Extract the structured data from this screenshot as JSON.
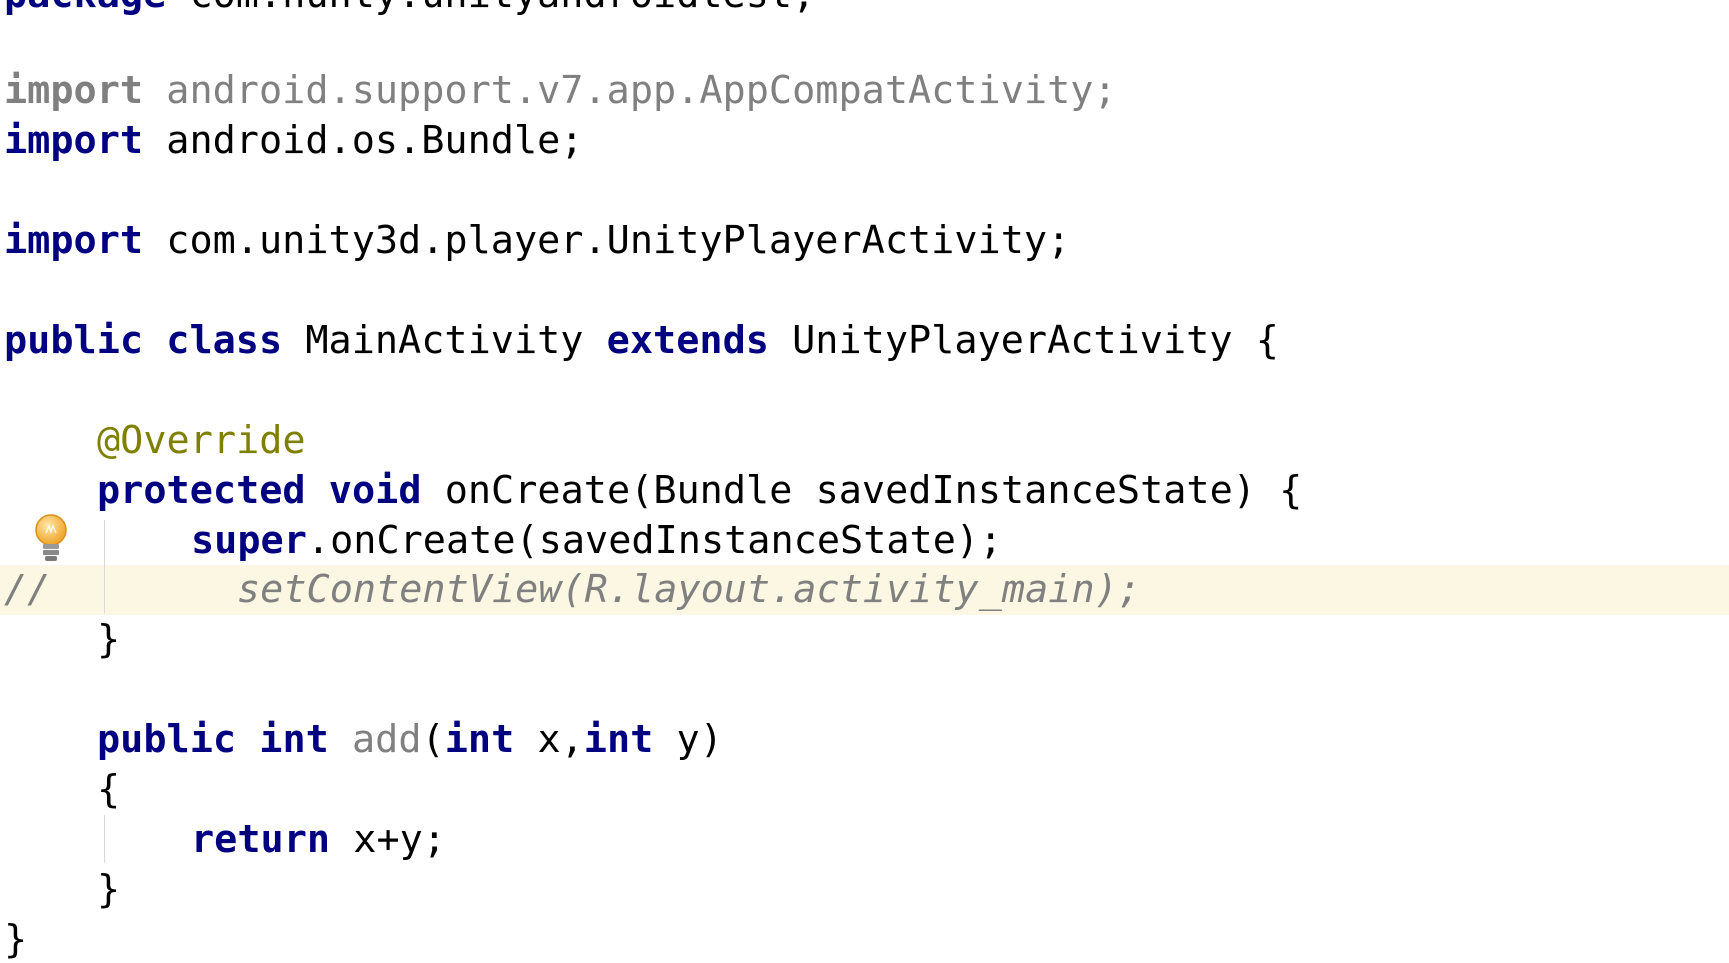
{
  "editor": {
    "lines": [
      {
        "id": "package",
        "tokens": [
          {
            "t": "package ",
            "c": "kw"
          },
          {
            "t": "com.hunty.unityandroidtest;",
            "c": "plain"
          }
        ]
      },
      {
        "id": "import-appcompat",
        "tokens": [
          {
            "t": "import ",
            "c": "unused-kw"
          },
          {
            "t": "android.support.v7.app.AppCompatActivity;",
            "c": "unused"
          }
        ]
      },
      {
        "id": "import-bundle",
        "tokens": [
          {
            "t": "import ",
            "c": "kw"
          },
          {
            "t": "android.os.Bundle;",
            "c": "plain"
          }
        ]
      },
      {
        "id": "import-unity",
        "tokens": [
          {
            "t": "import ",
            "c": "kw"
          },
          {
            "t": "com.unity3d.player.UnityPlayerActivity;",
            "c": "plain"
          }
        ]
      },
      {
        "id": "class-decl",
        "tokens": [
          {
            "t": "public ",
            "c": "kw"
          },
          {
            "t": "class ",
            "c": "kw"
          },
          {
            "t": "MainActivity ",
            "c": "plain"
          },
          {
            "t": "extends ",
            "c": "kw"
          },
          {
            "t": "UnityPlayerActivity {",
            "c": "plain"
          }
        ]
      },
      {
        "id": "override",
        "tokens": [
          {
            "t": "@Override",
            "c": "ann"
          }
        ]
      },
      {
        "id": "oncreate-decl",
        "tokens": [
          {
            "t": "protected ",
            "c": "kw"
          },
          {
            "t": "void ",
            "c": "kw"
          },
          {
            "t": "onCreate(Bundle savedInstanceState) {",
            "c": "plain"
          }
        ]
      },
      {
        "id": "super-call",
        "tokens": [
          {
            "t": "super",
            "c": "kw"
          },
          {
            "t": ".onCreate(savedInstanceState);",
            "c": "plain"
          }
        ]
      },
      {
        "id": "comment-prefix",
        "tokens": [
          {
            "t": "//",
            "c": "cmt"
          }
        ]
      },
      {
        "id": "commented-setcontentview",
        "tokens": [
          {
            "t": "setContentView(R.layout.activity_main);",
            "c": "cmt"
          }
        ]
      },
      {
        "id": "close-oncreate",
        "tokens": [
          {
            "t": "}",
            "c": "plain"
          }
        ]
      },
      {
        "id": "add-decl",
        "tokens": [
          {
            "t": "public ",
            "c": "kw"
          },
          {
            "t": "int ",
            "c": "kw"
          },
          {
            "t": "add",
            "c": "unused"
          },
          {
            "t": "(",
            "c": "plain"
          },
          {
            "t": "int ",
            "c": "kw"
          },
          {
            "t": "x,",
            "c": "plain"
          },
          {
            "t": "int ",
            "c": "kw"
          },
          {
            "t": "y)",
            "c": "plain"
          }
        ]
      },
      {
        "id": "open-add",
        "tokens": [
          {
            "t": "{",
            "c": "plain"
          }
        ]
      },
      {
        "id": "return-stmt",
        "tokens": [
          {
            "t": "return ",
            "c": "kw"
          },
          {
            "t": "x+y;",
            "c": "plain"
          }
        ]
      },
      {
        "id": "close-add",
        "tokens": [
          {
            "t": "}",
            "c": "plain"
          }
        ]
      },
      {
        "id": "close-class",
        "tokens": [
          {
            "t": "}",
            "c": "plain"
          }
        ]
      }
    ],
    "gutter_icon": "lightbulb-icon",
    "colors": {
      "keyword": "#000080",
      "annotation": "#808000",
      "unused": "#808080",
      "comment": "#808080",
      "current_line": "#fbf7e3"
    }
  }
}
